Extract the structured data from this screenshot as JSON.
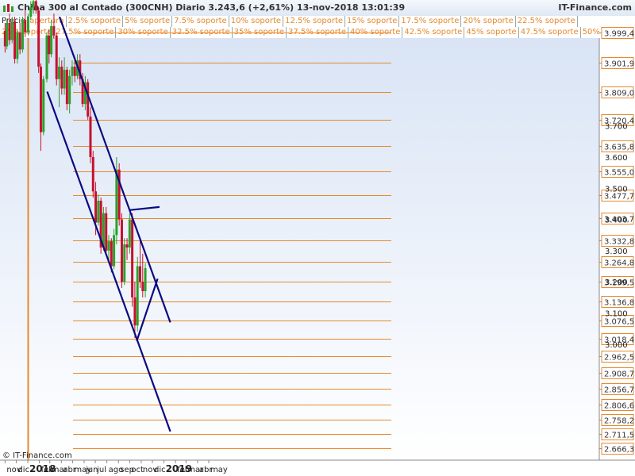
{
  "window": {
    "title": "China 300 al Contado (300CNH)   Diario   3.243,6 (+2,61%)   13-nov-2018 13:01:39",
    "brand": "IT-Finance.com",
    "copyright": "© IT-Finance.com"
  },
  "legend_row1": [
    "Precio",
    "apertura",
    "2.5% soporte",
    "5% soporte",
    "7.5% soporte",
    "10% soporte",
    "12.5% soporte",
    "15% soporte",
    "17.5% soporte",
    "20% soporte",
    "22.5% soporte"
  ],
  "legend_row2": [
    "25% soporte",
    "27.5% soporte",
    "30% soporte",
    "32.5% soporte",
    "35% soporte",
    "37.5% soporte",
    "40% soporte",
    "42.5% soporte",
    "45% soporte",
    "47.5% soporte",
    "50% so"
  ],
  "colors": {
    "candle_up": "#2ca02c",
    "candle_down": "#c8102e",
    "support": "#e6892d",
    "trend": "#0a0a80",
    "open_line": "#e6892d",
    "axis_bg": "#ffffff"
  },
  "chart_data": {
    "type": "candlestick",
    "instrument": "China 300 al Contado (300CNH)",
    "timeframe": "Diario",
    "last": "3.243,6",
    "change": "+2,61%",
    "timestamp": "13-nov-2018 13:01:39",
    "x_tick_labels": [
      "nov",
      "dic",
      "2018",
      "feb",
      "mar",
      "abr",
      "may",
      "jun",
      "jul",
      "ago",
      "sep",
      "oct",
      "nov",
      "dic",
      "2019",
      "feb",
      "mar",
      "abr",
      "may"
    ],
    "support_levels": [
      "3.999,4",
      "3.901,9",
      "3.809,0",
      "3.720,4",
      "3.635,8",
      "3.555,0",
      "3.477,7",
      "3.403,7",
      "3.332,8",
      "3.264,8",
      "3.199,5",
      "3.136,8",
      "3.076,5",
      "3.018,4",
      "2.962,5",
      "2.908,7",
      "2.856,7",
      "2.806,6",
      "2.758,2",
      "2.711,5",
      "2.666,3"
    ],
    "price_axis_labels": [
      "3.700",
      "3.600",
      "3.500",
      "3.400",
      "3.300",
      "3.200",
      "3.100",
      "3.000"
    ],
    "ylim": [
      2640,
      4010
    ],
    "candles": [
      [
        "2017-11-01",
        4005,
        4030,
        3935,
        3955
      ],
      [
        "2017-11-06",
        3955,
        4040,
        3945,
        4030
      ],
      [
        "2017-11-13",
        4030,
        4060,
        3960,
        3975
      ],
      [
        "2017-11-20",
        3975,
        4050,
        3965,
        4035
      ],
      [
        "2017-11-27",
        4035,
        4050,
        3900,
        3915
      ],
      [
        "2017-12-04",
        3915,
        4010,
        3900,
        4000
      ],
      [
        "2017-12-11",
        4000,
        4030,
        3930,
        3945
      ],
      [
        "2017-12-18",
        3945,
        4050,
        3935,
        4040
      ],
      [
        "2017-12-25",
        4040,
        4070,
        3985,
        4000
      ],
      [
        "2018-01-02",
        4000,
        4060,
        3990,
        4050
      ],
      [
        "2018-01-09",
        4050,
        4100,
        4040,
        4080
      ],
      [
        "2018-01-16",
        4080,
        4110,
        4060,
        4100
      ],
      [
        "2018-01-23",
        4100,
        4110,
        4060,
        4070
      ],
      [
        "2018-01-30",
        4070,
        4080,
        3870,
        3890
      ],
      [
        "2018-02-05",
        3890,
        3900,
        3620,
        3680
      ],
      [
        "2018-02-12",
        3680,
        3860,
        3670,
        3850
      ],
      [
        "2018-02-21",
        3850,
        4000,
        3840,
        3990
      ],
      [
        "2018-02-27",
        3990,
        4010,
        3900,
        3930
      ],
      [
        "2018-03-05",
        3930,
        4040,
        3920,
        4020
      ],
      [
        "2018-03-12",
        4020,
        4060,
        3980,
        3990
      ],
      [
        "2018-03-19",
        3990,
        4000,
        3830,
        3850
      ],
      [
        "2018-03-26",
        3850,
        3920,
        3760,
        3890
      ],
      [
        "2018-04-02",
        3890,
        3910,
        3800,
        3820
      ],
      [
        "2018-04-09",
        3820,
        3920,
        3800,
        3880
      ],
      [
        "2018-04-16",
        3880,
        3890,
        3750,
        3770
      ],
      [
        "2018-04-23",
        3770,
        3880,
        3740,
        3860
      ],
      [
        "2018-04-30",
        3860,
        3910,
        3830,
        3890
      ],
      [
        "2018-05-07",
        3890,
        3920,
        3840,
        3860
      ],
      [
        "2018-05-14",
        3860,
        3930,
        3850,
        3910
      ],
      [
        "2018-05-21",
        3910,
        3930,
        3830,
        3850
      ],
      [
        "2018-05-28",
        3850,
        3870,
        3760,
        3770
      ],
      [
        "2018-06-04",
        3770,
        3860,
        3750,
        3840
      ],
      [
        "2018-06-11",
        3840,
        3850,
        3720,
        3730
      ],
      [
        "2018-06-18",
        3730,
        3760,
        3580,
        3600
      ],
      [
        "2018-06-25",
        3600,
        3620,
        3470,
        3490
      ],
      [
        "2018-07-02",
        3490,
        3520,
        3350,
        3390
      ],
      [
        "2018-07-09",
        3390,
        3480,
        3380,
        3460
      ],
      [
        "2018-07-16",
        3460,
        3470,
        3290,
        3310
      ],
      [
        "2018-07-23",
        3310,
        3440,
        3300,
        3420
      ],
      [
        "2018-07-30",
        3420,
        3440,
        3290,
        3300
      ],
      [
        "2018-08-06",
        3300,
        3350,
        3260,
        3330
      ],
      [
        "2018-08-13",
        3330,
        3340,
        3230,
        3250
      ],
      [
        "2018-08-20",
        3250,
        3370,
        3240,
        3350
      ],
      [
        "2018-08-27",
        3350,
        3600,
        3320,
        3560
      ],
      [
        "2018-09-03",
        3560,
        3580,
        3380,
        3400
      ],
      [
        "2018-09-10",
        3400,
        3420,
        3180,
        3200
      ],
      [
        "2018-09-17",
        3200,
        3340,
        3190,
        3320
      ],
      [
        "2018-09-24",
        3320,
        3340,
        3270,
        3310
      ],
      [
        "2018-10-01",
        3310,
        3420,
        3290,
        3400
      ],
      [
        "2018-10-08",
        3400,
        3420,
        3120,
        3150
      ],
      [
        "2018-10-15",
        3150,
        3200,
        3020,
        3060
      ],
      [
        "2018-10-22",
        3060,
        3280,
        3040,
        3250
      ],
      [
        "2018-10-29",
        3250,
        3340,
        3180,
        3200
      ],
      [
        "2018-11-05",
        3200,
        3290,
        3150,
        3170
      ],
      [
        "2018-11-12",
        3170,
        3260,
        3150,
        3243.6
      ]
    ],
    "trend_lines": [
      {
        "name": "upper-channel",
        "from": [
          "2018-03-27",
          4050
        ],
        "to": [
          "2019-01-18",
          3070
        ]
      },
      {
        "name": "lower-channel",
        "from": [
          "2018-02-22",
          3810
        ],
        "to": [
          "2019-01-18",
          2720
        ]
      },
      {
        "name": "resistance-line",
        "from": [
          "2018-10-01",
          3430
        ],
        "to": [
          "2018-12-20",
          3440
        ]
      },
      {
        "name": "rising-support",
        "from": [
          "2018-10-20",
          3010
        ],
        "to": [
          "2018-12-15",
          3210
        ]
      }
    ],
    "opening_marker_date": "2018-01-02"
  }
}
